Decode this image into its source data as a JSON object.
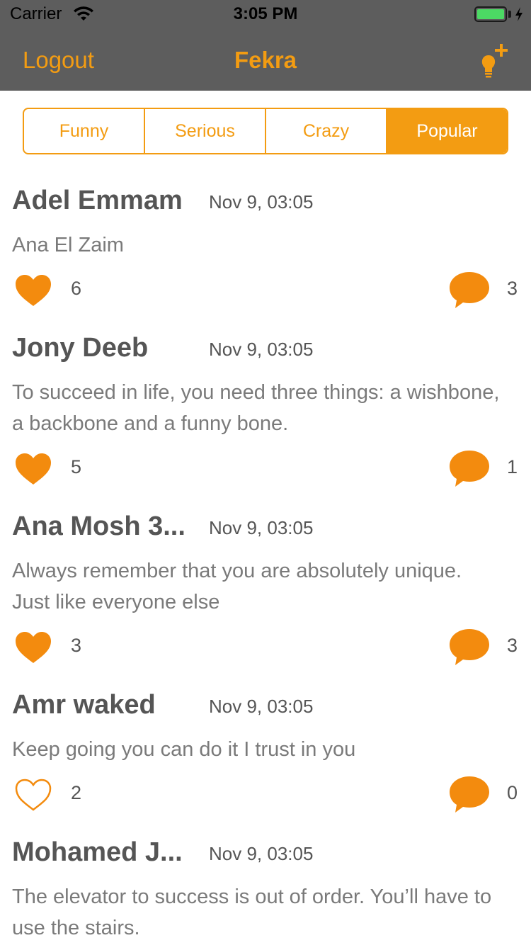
{
  "status_bar": {
    "carrier": "Carrier",
    "time": "3:05 PM",
    "battery_color": "#4cd964"
  },
  "nav": {
    "left_label": "Logout",
    "title": "Fekra",
    "right_icon": "add-idea-lightbulb-icon",
    "accent_color": "#f39c12",
    "bar_color": "#5d5d5d"
  },
  "segments": {
    "items": [
      "Funny",
      "Serious",
      "Crazy",
      "Popular"
    ],
    "selected": "Popular"
  },
  "posts": [
    {
      "author": "Adel Emmam",
      "date": "Nov 9, 03:05",
      "text": "Ana El Zaim",
      "likes": "6",
      "comments": "3",
      "liked": true
    },
    {
      "author": "Jony Deeb",
      "date": "Nov 9, 03:05",
      "text": "To succeed in life, you need three things: a wishbone, a backbone and a funny bone.",
      "likes": "5",
      "comments": "1",
      "liked": true
    },
    {
      "author": "Ana Mosh 3...",
      "date": "Nov 9, 03:05",
      "text": "Always remember that you are absolutely unique. Just like everyone else",
      "likes": "3",
      "comments": "3",
      "liked": true
    },
    {
      "author": "Amr waked",
      "date": "Nov 9, 03:05",
      "text": "Keep going you can do it I trust in you",
      "likes": "2",
      "comments": "0",
      "liked": false
    },
    {
      "author": "Mohamed J...",
      "date": "Nov 9, 03:05",
      "text": "The elevator to success is out of order. You’ll have to use the stairs."
    }
  ]
}
